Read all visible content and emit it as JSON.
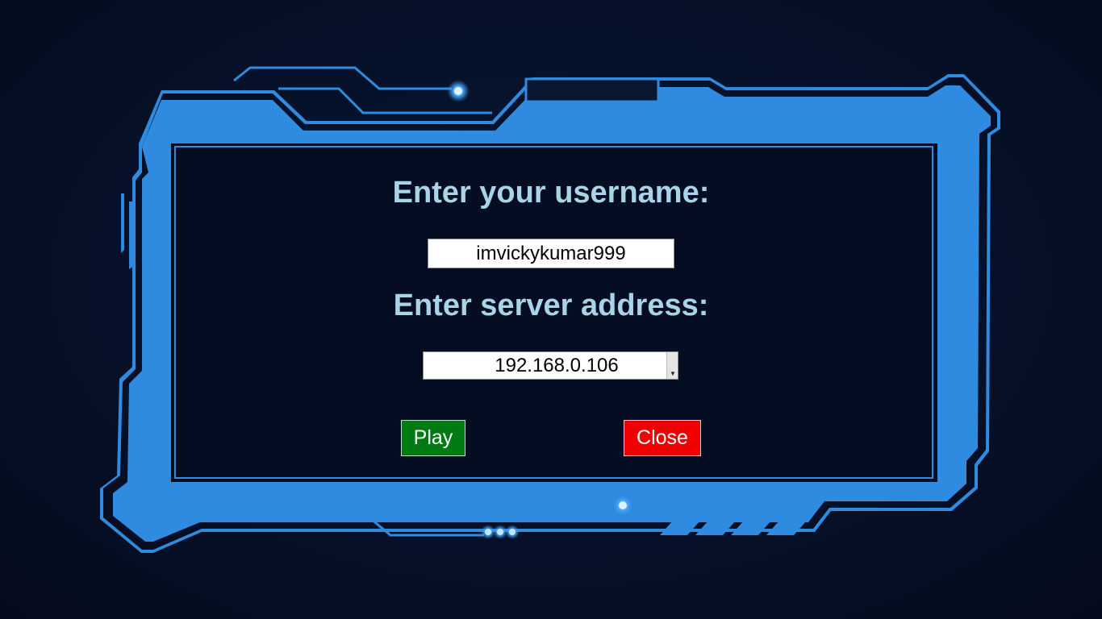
{
  "login": {
    "username_label": "Enter your username:",
    "username_value": "imvickykumar999",
    "server_label": "Enter server address:",
    "server_value": "192.168.0.106",
    "play_label": "Play",
    "close_label": "Close"
  },
  "colors": {
    "frame_blue": "#2f8be0",
    "label_color": "#a9d3e6",
    "play_green": "#007a12",
    "close_red": "#f00000"
  },
  "icons": {
    "dropdown": "chevron-down-icon"
  }
}
